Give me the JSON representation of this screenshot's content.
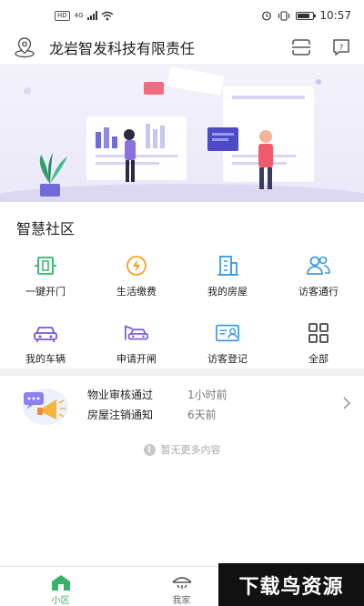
{
  "statusbar": {
    "network_badge": "HD",
    "signal_label": "4G",
    "time": "10:57"
  },
  "header": {
    "title": "龙岩智发科技有限责任",
    "location_icon": "location-pin-icon",
    "scan_icon": "scan-icon",
    "message_icon": "message-icon"
  },
  "section_title": "智慧社区",
  "grid": [
    {
      "label": "一键开门",
      "icon": "door-open-icon",
      "color": "#2fb36a"
    },
    {
      "label": "生活缴费",
      "icon": "lightning-icon",
      "color": "#f2a61c"
    },
    {
      "label": "我的房屋",
      "icon": "building-icon",
      "color": "#3b9ae8"
    },
    {
      "label": "访客通行",
      "icon": "visitors-icon",
      "color": "#3b9ae8"
    },
    {
      "label": "我的车辆",
      "icon": "car-icon",
      "color": "#7b56d6"
    },
    {
      "label": "申请开闸",
      "icon": "gate-car-icon",
      "color": "#7b56d6"
    },
    {
      "label": "访客登记",
      "icon": "id-card-icon",
      "color": "#3b9ae8"
    },
    {
      "label": "全部",
      "icon": "grid-all-icon",
      "color": "#444444"
    }
  ],
  "notices": [
    {
      "title": "物业审核通过",
      "time": "1小时前"
    },
    {
      "title": "房屋注销通知",
      "time": "6天前"
    }
  ],
  "no_more": "暂无更多内容",
  "tabs": [
    {
      "label": "小区",
      "icon": "home-icon",
      "active": true
    },
    {
      "label": "我家",
      "icon": "house-hand-icon",
      "active": false
    },
    {
      "label": "",
      "icon": "",
      "active": false
    }
  ],
  "watermark": "下载鸟资源",
  "colors": {
    "accent": "#37b267"
  }
}
